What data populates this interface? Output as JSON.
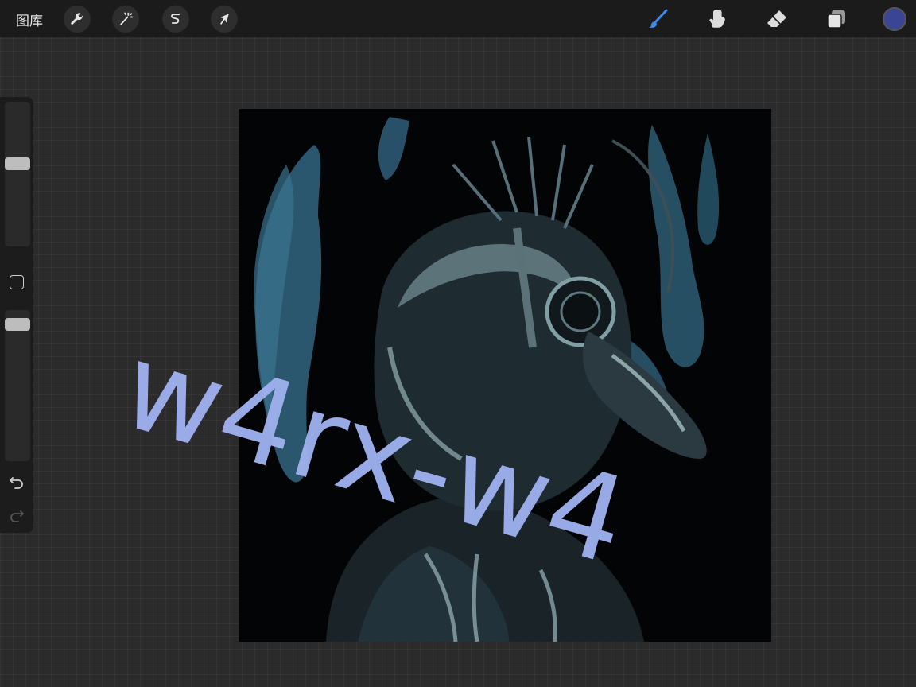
{
  "topbar": {
    "gallery_label": "图库",
    "left_tools": [
      {
        "name": "actions",
        "icon": "wrench-icon"
      },
      {
        "name": "adjustments",
        "icon": "magic-wand-icon"
      },
      {
        "name": "selection",
        "icon": "selection-s-icon"
      },
      {
        "name": "transform",
        "icon": "arrow-cursor-icon"
      }
    ],
    "right_tools": [
      {
        "name": "brush",
        "icon": "brush-icon",
        "active": true,
        "color": "#3d8bf2"
      },
      {
        "name": "smudge",
        "icon": "smudge-finger-icon"
      },
      {
        "name": "eraser",
        "icon": "eraser-icon"
      },
      {
        "name": "layers",
        "icon": "layers-icon"
      }
    ],
    "current_color": "#3a4596"
  },
  "sidebar": {
    "brush_size": 0.47,
    "opacity": 0.98,
    "modify_icon": "square-icon",
    "undo_icon": "undo-icon",
    "redo_icon": "redo-icon"
  },
  "canvas": {
    "background": "#030405",
    "artwork": "plague-doctor-mask-illustration"
  },
  "watermark": {
    "text": "w4rx-w4",
    "color": "#9fb1ef"
  }
}
